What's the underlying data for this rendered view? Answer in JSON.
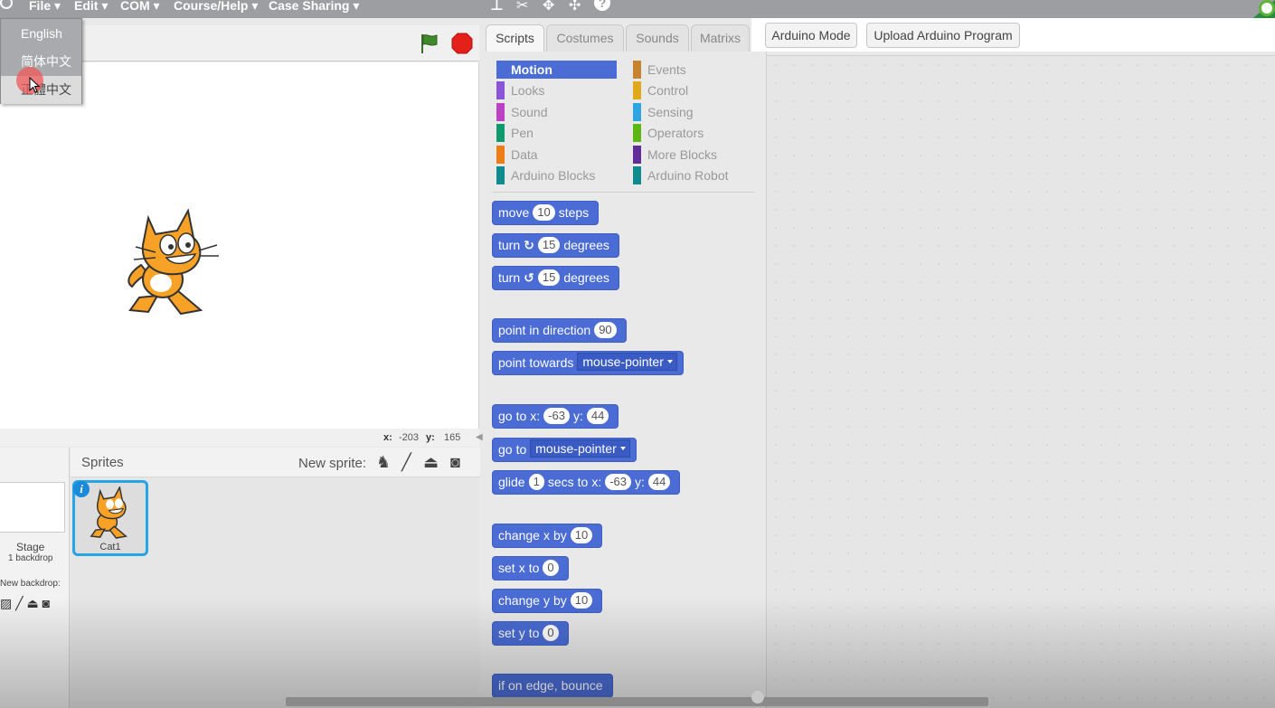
{
  "menubar": {
    "items": [
      "File",
      "Edit",
      "COM",
      "Course/Help",
      "Case Sharing"
    ],
    "help_symbol": "?"
  },
  "language_menu": {
    "items": [
      "English",
      "简体中文",
      "正體中文"
    ],
    "hovered_index": 2
  },
  "stage": {
    "x_label": "x:",
    "x_value": "-203",
    "y_label": "y:",
    "y_value": "165"
  },
  "stage_pane": {
    "label": "Stage",
    "backdrops": "1 backdrop",
    "new_backdrop": "New backdrop:"
  },
  "sprites": {
    "title": "Sprites",
    "new_sprite": "New sprite:",
    "selected_sprite": "Cat1",
    "info_badge": "i"
  },
  "tabs": [
    "Scripts",
    "Costumes",
    "Sounds",
    "Matrixs"
  ],
  "toolbar": {
    "arduino_mode": "Arduino Mode",
    "upload": "Upload Arduino Program"
  },
  "categories": {
    "left": [
      {
        "label": "Motion",
        "color": "#4a6cd4"
      },
      {
        "label": "Looks",
        "color": "#8a55d7"
      },
      {
        "label": "Sound",
        "color": "#bb42c3"
      },
      {
        "label": "Pen",
        "color": "#0e9a6c"
      },
      {
        "label": "Data",
        "color": "#ee7d16"
      },
      {
        "label": "Arduino Blocks",
        "color": "#0f8b8d"
      }
    ],
    "right": [
      {
        "label": "Events",
        "color": "#c88330"
      },
      {
        "label": "Control",
        "color": "#e1a91a"
      },
      {
        "label": "Sensing",
        "color": "#2ca5e2"
      },
      {
        "label": "Operators",
        "color": "#5cb712"
      },
      {
        "label": "More Blocks",
        "color": "#632d99"
      },
      {
        "label": "Arduino Robot",
        "color": "#0f8b8d"
      }
    ]
  },
  "blocks": {
    "move": {
      "a": "move",
      "n": "10",
      "b": "steps"
    },
    "turn_cw": {
      "a": "turn",
      "n": "15",
      "b": "degrees"
    },
    "turn_ccw": {
      "a": "turn",
      "n": "15",
      "b": "degrees"
    },
    "point_dir": {
      "a": "point",
      "b": "in",
      "c": "direction",
      "n": "90"
    },
    "point_towards": {
      "a": "point",
      "b": "towards",
      "d": "mouse-pointer"
    },
    "goto_xy": {
      "a": "go",
      "b": "to",
      "c": "x:",
      "n1": "-63",
      "d": "y:",
      "n2": "44"
    },
    "goto": {
      "a": "go",
      "b": "to",
      "d": "mouse-pointer"
    },
    "glide": {
      "a": "glide",
      "n1": "1",
      "b": "secs",
      "c": "to",
      "d": "x:",
      "n2": "-63",
      "e": "y:",
      "n3": "44"
    },
    "change_x": {
      "a": "change",
      "b": "x",
      "c": "by",
      "n": "10"
    },
    "set_x": {
      "a": "set",
      "b": "x",
      "c": "to",
      "n": "0"
    },
    "change_y": {
      "a": "change",
      "b": "y",
      "c": "by",
      "n": "10"
    },
    "set_y": {
      "a": "set",
      "b": "y",
      "c": "to",
      "n": "0"
    },
    "bounce": {
      "a": "if",
      "b": "on",
      "c": "edge,",
      "d": "bounce"
    }
  }
}
